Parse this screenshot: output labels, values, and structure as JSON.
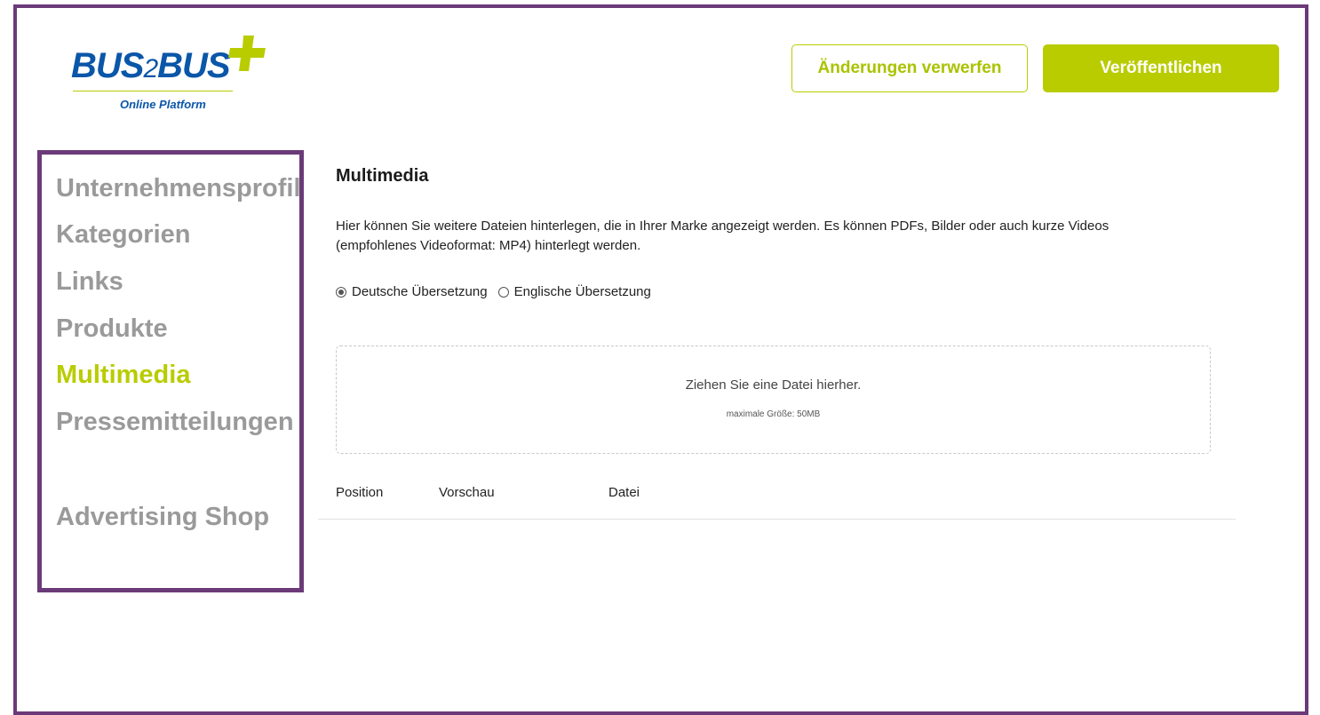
{
  "logo": {
    "text_main": "BUS",
    "text_two": "2",
    "text_end": "BUS",
    "subtitle": "Online Platform",
    "icon": "plus-icon",
    "colors": {
      "blue": "#0a56a8",
      "green": "#b9cc00"
    }
  },
  "header": {
    "discard_label": "Änderungen verwerfen",
    "publish_label": "Veröffentlichen"
  },
  "sidebar": {
    "items": [
      {
        "label": "Unternehmensprofil",
        "active": false
      },
      {
        "label": "Kategorien",
        "active": false
      },
      {
        "label": "Links",
        "active": false
      },
      {
        "label": "Produkte",
        "active": false
      },
      {
        "label": "Multimedia",
        "active": true
      },
      {
        "label": "Pressemitteilungen",
        "active": false
      },
      {
        "label": "Advertising Shop",
        "active": false
      }
    ]
  },
  "content": {
    "title": "Multimedia",
    "description": "Hier können Sie weitere Dateien hinterlegen, die in Ihrer Marke angezeigt werden. Es können PDFs, Bilder oder auch kurze Videos (empfohlenes Videoformat: MP4) hinterlegt werden.",
    "languages": [
      {
        "label": "Deutsche Übersetzung",
        "checked": true
      },
      {
        "label": "Englische Übersetzung",
        "checked": false
      }
    ],
    "dropzone": {
      "main": "Ziehen Sie eine Datei hierher.",
      "sub": "maximale Größe: 50MB"
    },
    "table_headers": [
      "Position",
      "Vorschau",
      "Datei"
    ]
  },
  "colors": {
    "accent": "#b9cc00",
    "frame": "#6b3a78",
    "nav_inactive": "#9a9a9a"
  }
}
